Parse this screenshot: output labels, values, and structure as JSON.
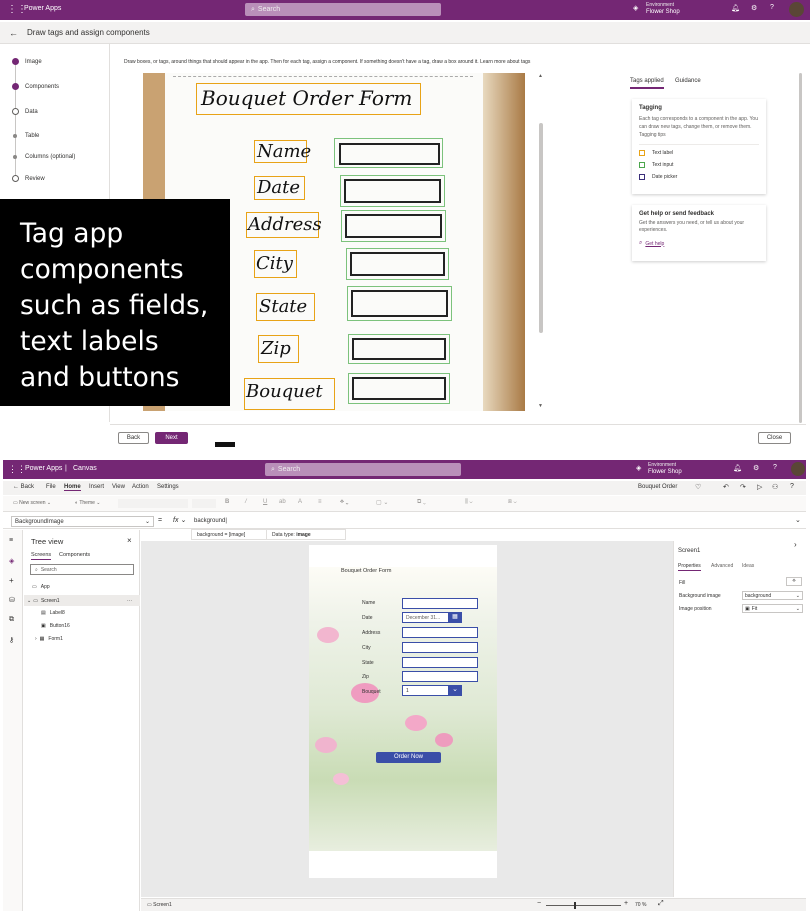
{
  "top": {
    "app_title": "Power Apps",
    "search_placeholder": "Search",
    "env_label": "Environment",
    "env_name": "Flower Shop",
    "page_title": "Draw tags and assign components",
    "instructions": "Draw boxes, or tags, around things that should appear in the app. Then for each tag, assign a component. If something doesn't have a tag, draw a box around it. Learn more about tags",
    "steps": [
      "Image",
      "Components",
      "Data",
      "Table",
      "Columns (optional)",
      "Review"
    ],
    "sketch": {
      "title": "Bouquet Order Form",
      "fields": [
        "Name",
        "Date",
        "Address",
        "City",
        "State",
        "Zip",
        "Bouquet"
      ]
    },
    "right_tabs": [
      "Tags applied",
      "Guidance"
    ],
    "tagging": {
      "heading": "Tagging",
      "desc": "Each tag corresponds to a component in the app. You can draw new tags, change them, or remove them. Tagging tips",
      "legend": [
        {
          "label": "Text label",
          "color": "#e8a317"
        },
        {
          "label": "Text input",
          "color": "#4ca64c"
        },
        {
          "label": "Date picker",
          "color": "#3b2f7a"
        }
      ]
    },
    "help": {
      "heading": "Get help or send feedback",
      "desc": "Get the answers you need, or tell us about your experiences.",
      "link": "Get help"
    },
    "back": "Back",
    "next": "Next",
    "close": "Close"
  },
  "overlay": {
    "text": "Tag app components such as fields, text labels and buttons"
  },
  "studio": {
    "app_title": "Power Apps",
    "sep": "|",
    "mode": "Canvas",
    "search_placeholder": "Search",
    "env_label": "Environment",
    "env_name": "Flower Shop",
    "menu": [
      "Back",
      "File",
      "Home",
      "Insert",
      "View",
      "Action",
      "Settings"
    ],
    "app_name": "Bouquet Order",
    "new_screen": "New screen",
    "theme": "Theme",
    "property": "BackgroundImage",
    "equals": "=",
    "fx": "fx",
    "formula": "background",
    "hint_left": "background = [image]",
    "hint_right_label": "Data type: ",
    "hint_right_value": "image",
    "tree_title": "Tree view",
    "tree_tabs": [
      "Screens",
      "Components"
    ],
    "tree_search": "Search",
    "tree": [
      "App",
      "Screen1",
      "Label8",
      "Button16",
      "Form1"
    ],
    "form": {
      "title": "Bouquet Order Form",
      "labels": [
        "Name",
        "Date",
        "Address",
        "City",
        "State",
        "Zip",
        "Bouquet"
      ],
      "date_value": "December 31...",
      "bouquet_value": "1",
      "button": "Order Now"
    },
    "props": {
      "screen": "Screen1",
      "tabs": [
        "Properties",
        "Advanced",
        "Ideas"
      ],
      "fill": "Fill",
      "bg_image_label": "Background image",
      "bg_image_value": "background",
      "position_label": "Image position",
      "position_value": "Fit"
    },
    "status": {
      "screen": "Screen1",
      "zoom": "70 %"
    }
  }
}
